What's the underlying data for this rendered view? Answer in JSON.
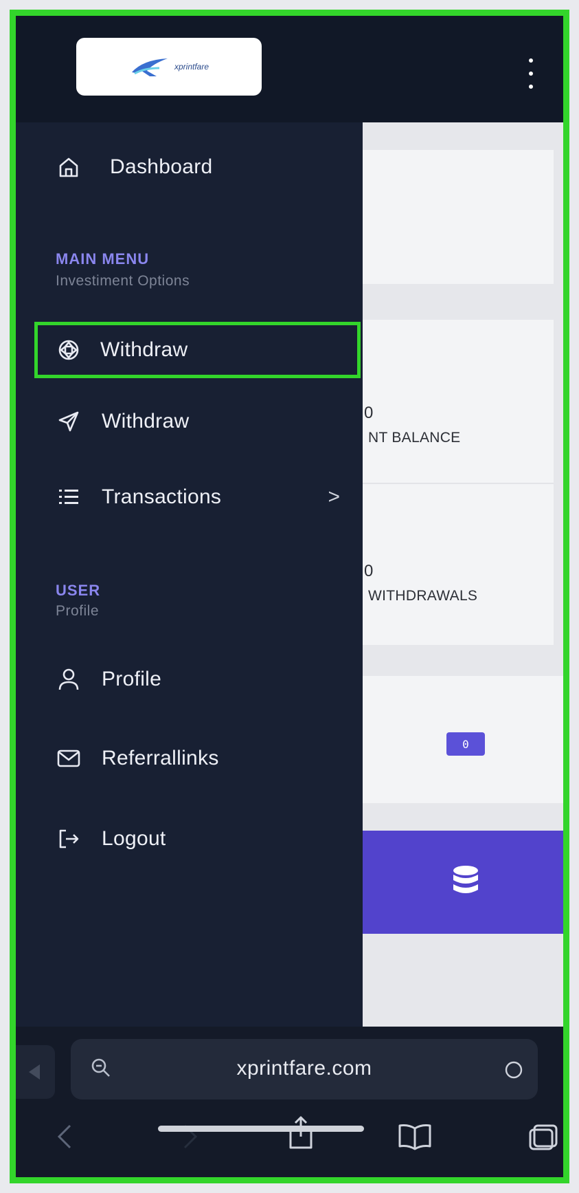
{
  "header": {
    "logo_text": "xprintfare",
    "menu_icon": "kebab-icon"
  },
  "sidebar": {
    "dashboard_label": "Dashboard",
    "main_section": {
      "title": "MAIN MENU",
      "subtitle": "Investiment Options"
    },
    "items": [
      {
        "label": "Withdraw",
        "icon": "crosshair-icon",
        "highlighted": true
      },
      {
        "label": "Withdraw",
        "icon": "send-icon"
      },
      {
        "label": "Transactions",
        "icon": "list-icon",
        "has_submenu": true
      }
    ],
    "user_section": {
      "title": "USER",
      "subtitle": "Profile"
    },
    "user_items": [
      {
        "label": "Profile",
        "icon": "user-icon"
      },
      {
        "label": "Referrallinks",
        "icon": "mail-icon"
      },
      {
        "label": "Logout",
        "icon": "logout-icon"
      }
    ]
  },
  "background_cards": {
    "balance_value": "0",
    "balance_label": "NT BALANCE",
    "withdrawals_value": "0",
    "withdrawals_label": "WITHDRAWALS",
    "cash_badge": "0"
  },
  "browser": {
    "url": "xprintfare.com"
  },
  "colors": {
    "highlight": "#33d52b",
    "accent": "#5243cc",
    "sidebar_bg": "#182033",
    "section_title": "#8a86ee"
  }
}
